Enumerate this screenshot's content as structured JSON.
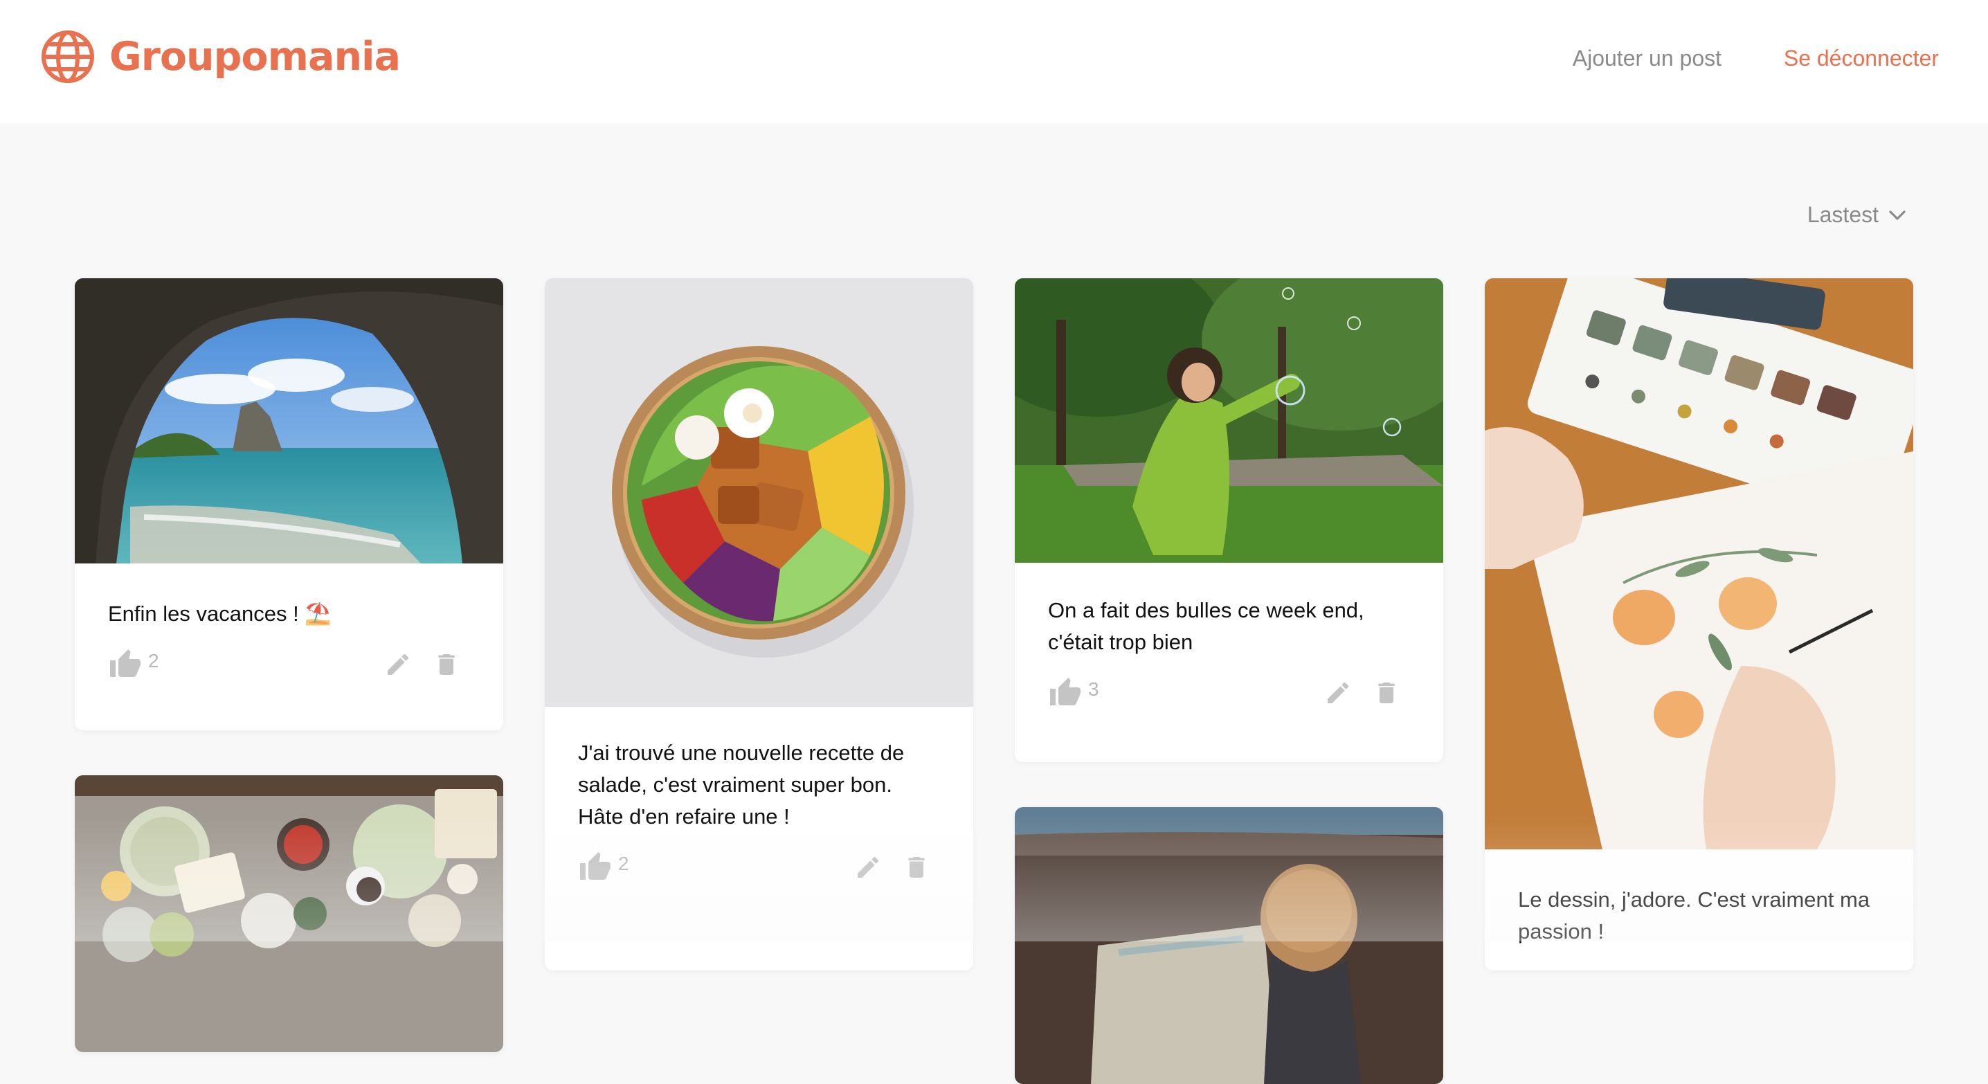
{
  "brand": {
    "name": "Groupomania"
  },
  "nav": {
    "add_post": "Ajouter un post",
    "logout": "Se déconnecter"
  },
  "sort": {
    "selected": "Lastest"
  },
  "posts": [
    {
      "text": "Enfin les vacances ! ⛱️",
      "likes": "2",
      "image": "sea-cave-photo"
    },
    {
      "text": "J'ai trouvé une nouvelle recette de salade, c'est vraiment super bon. Hâte d'en refaire une !",
      "likes": "2",
      "image": "salad-bowl-photo"
    },
    {
      "text": "On a fait des bulles ce week end, c'était trop bien",
      "likes": "3",
      "image": "girl-bubbles-photo"
    },
    {
      "text": "Le dessin, j'adore. C'est vraiment ma passion !",
      "image": "watercolor-painting-photo"
    },
    {
      "image": "food-table-photo"
    },
    {
      "image": "child-map-photo"
    }
  ],
  "colors": {
    "accent": "#e8714f",
    "muted": "#8a8a8a",
    "icon": "#c4c4c4"
  }
}
